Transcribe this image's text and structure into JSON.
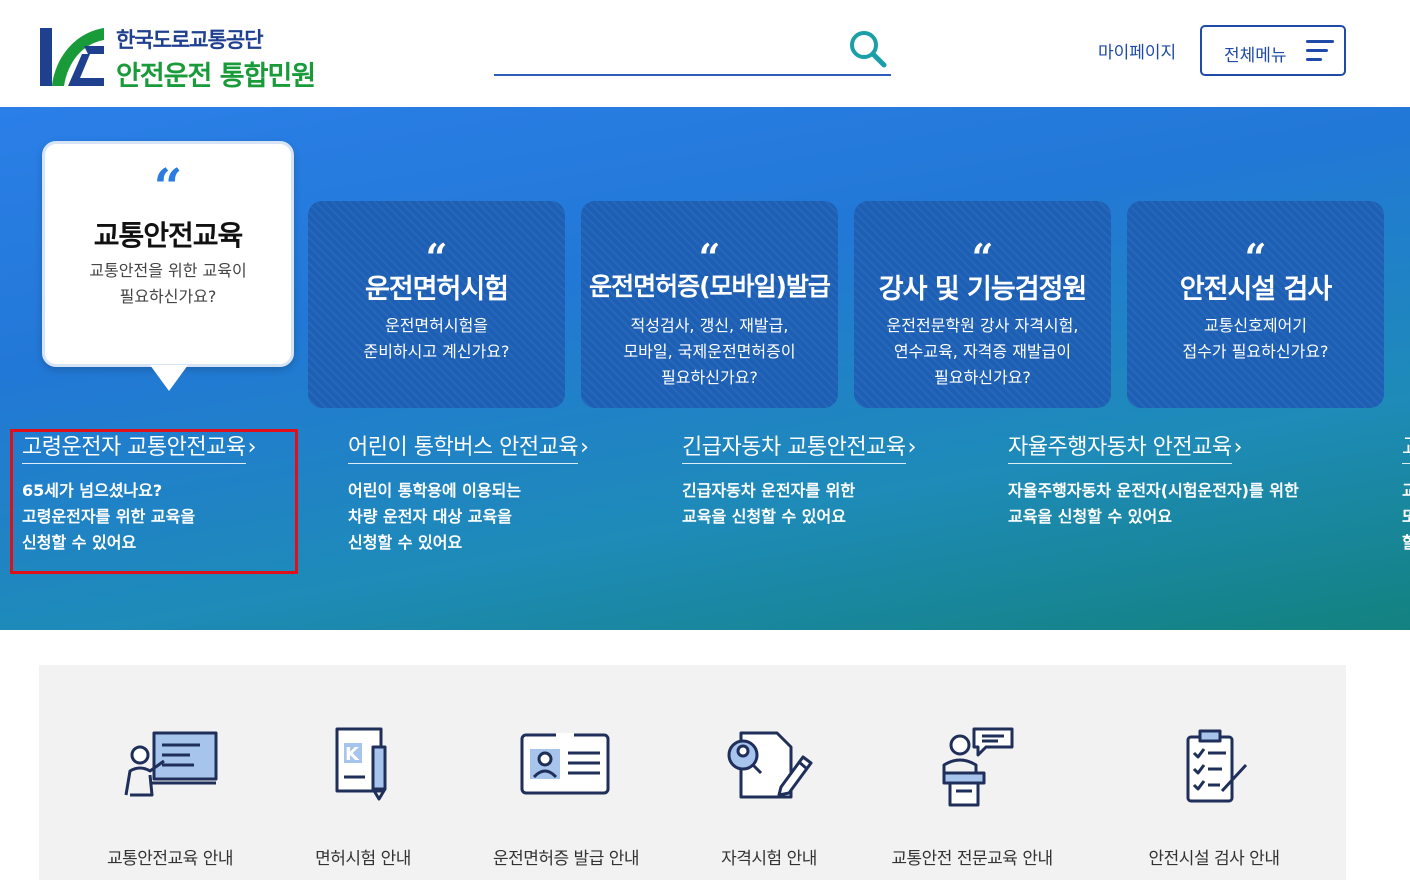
{
  "header": {
    "logo": {
      "org": "한국도로교통공단",
      "title": "안전운전 통합민원",
      "mark": "K"
    },
    "search": {
      "placeholder": "",
      "value": ""
    },
    "mypage_label": "마이페이지",
    "allmenu_label": "전체메뉴"
  },
  "hero": {
    "featured": {
      "title": "교통안전교육",
      "desc_line1": "교통안전을 위한 교육이",
      "desc_line2": "필요하신가요?"
    },
    "cards": [
      {
        "title": "운전면허시험",
        "lines": [
          "운전면허시험을",
          "준비하시고 계신가요?"
        ]
      },
      {
        "title": "운전면허증(모바일)발급",
        "lines": [
          "적성검사, 갱신, 재발급,",
          "모바일, 국제운전면허증이",
          "필요하신가요?"
        ]
      },
      {
        "title": "강사 및 기능검정원",
        "lines": [
          "운전전문학원 강사 자격시험,",
          "연수교육, 자격증 재발급이",
          "필요하신가요?"
        ]
      },
      {
        "title": "안전시설 검사",
        "lines": [
          "교통신호제어기",
          "접수가 필요하신가요?"
        ]
      }
    ],
    "education": [
      {
        "title": "고령운전자 교통안전교육",
        "lines": [
          "65세가 넘으셨나요?",
          "고령운전자를 위한 교육을",
          "신청할 수 있어요"
        ]
      },
      {
        "title": "어린이 통학버스 안전교육",
        "lines": [
          "어린이 통학용에 이용되는",
          "차량 운전자 대상 교육을",
          "신청할 수 있어요"
        ]
      },
      {
        "title": "긴급자동차 교통안전교육",
        "lines": [
          "긴급자동차 운전자를 위한",
          "교육을 신청할 수 있어요"
        ]
      },
      {
        "title": "자율주행자동차 안전교육",
        "lines": [
          "자율주행자동차 운전자(시험운전자)를 위한",
          "교육을 신청할 수 있어요"
        ]
      },
      {
        "title": "교",
        "lines": [
          "교",
          "또",
          "할"
        ]
      }
    ]
  },
  "quick_menu": [
    {
      "label": "교통안전교육 안내",
      "icon": "presentation-icon"
    },
    {
      "label": "면허시험 안내",
      "icon": "license-book-icon"
    },
    {
      "label": "운전면허증 발급 안내",
      "icon": "id-card-icon"
    },
    {
      "label": "자격시험 안내",
      "icon": "exam-document-icon"
    },
    {
      "label": "교통안전 전문교육 안내",
      "icon": "lecturer-icon"
    },
    {
      "label": "안전시설 검사 안내",
      "icon": "checklist-icon"
    }
  ],
  "colors": {
    "brand_navy": "#1f3f8f",
    "brand_green": "#1a9b3a",
    "accent_blue": "#1f4aa8",
    "card_blue": "#1c5fb4",
    "highlight_red": "#e0101a"
  }
}
